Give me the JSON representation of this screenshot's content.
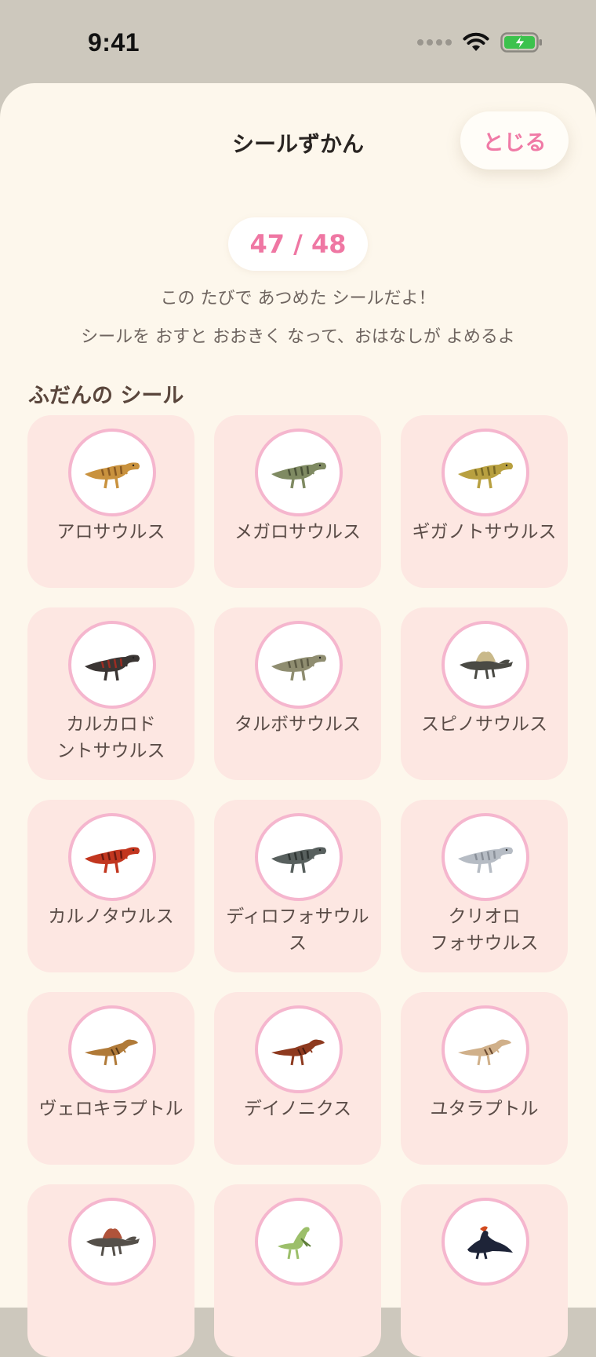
{
  "status_bar": {
    "time": "9:41"
  },
  "header": {
    "title": "シールずかん",
    "close_label": "とじる"
  },
  "progress": {
    "counter": "47 / 48",
    "collected": 47,
    "total": 48
  },
  "messages": [
    "この たびで あつめた シールだよ！",
    "シールを おすと おおきく なって、おはなしが よめるよ"
  ],
  "section": {
    "title": "ふだんの シール"
  },
  "stickers": [
    {
      "name": "アロサウルス",
      "color": "#c9923e",
      "stripe": "#8a5a22",
      "type": "theropod"
    },
    {
      "name": "メガロサウルス",
      "color": "#7f8a62",
      "stripe": "#4a5238",
      "type": "theropod"
    },
    {
      "name": "ギガノトサウルス",
      "color": "#b8a040",
      "stripe": "#7a6a25",
      "type": "theropod"
    },
    {
      "name": "カルカロド\nントサウルス",
      "color": "#3a3533",
      "stripe": "#9b2c22",
      "type": "theropod"
    },
    {
      "name": "タルボサウルス",
      "color": "#8f8d70",
      "stripe": "#5d5b45",
      "type": "theropod"
    },
    {
      "name": "スピノサウルス",
      "color": "#4a4a44",
      "stripe": "#c9b98a",
      "type": "sail"
    },
    {
      "name": "カルノタウルス",
      "color": "#c2361f",
      "stripe": "#6e1a10",
      "type": "theropod"
    },
    {
      "name": "ディロフォサウルス",
      "color": "#58605e",
      "stripe": "#2f3533",
      "type": "theropod"
    },
    {
      "name": "クリオロ\nフォサウルス",
      "color": "#b6bcc4",
      "stripe": "#8a9099",
      "type": "theropod"
    },
    {
      "name": "ヴェロキラプトル",
      "color": "#b07a38",
      "stripe": "#5a3a18",
      "type": "raptor"
    },
    {
      "name": "デイノニクス",
      "color": "#8e3a1f",
      "stripe": "#4a1c10",
      "type": "raptor"
    },
    {
      "name": "ユタラプトル",
      "color": "#d0b08a",
      "stripe": "#6b4a30",
      "type": "raptor"
    },
    {
      "name": "",
      "color": "#55504a",
      "stripe": "#b0533a",
      "type": "sail"
    },
    {
      "name": "",
      "color": "#9cbf6a",
      "stripe": "#5e7e3a",
      "type": "therizino"
    },
    {
      "name": "",
      "color": "#1e2438",
      "stripe": "#d24a1e",
      "type": "bird"
    }
  ]
}
